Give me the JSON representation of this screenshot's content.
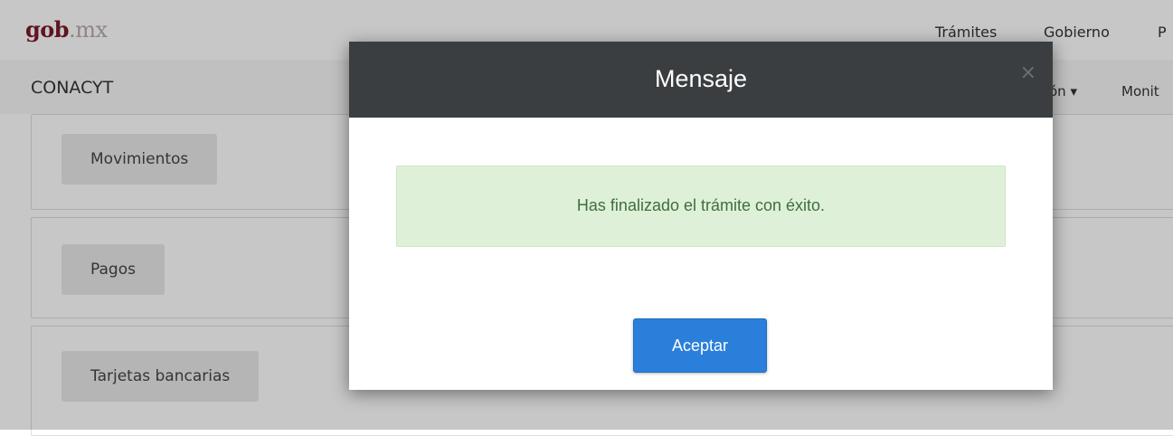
{
  "header": {
    "logo_part1": "gob",
    "logo_part2": ".mx",
    "nav": [
      "Trámites",
      "Gobierno",
      "P"
    ]
  },
  "subnav": {
    "title": "CONACYT",
    "items": [
      "ón ▾",
      "Monit"
    ]
  },
  "panels": [
    "Movimientos",
    "Pagos",
    "Tarjetas bancarias"
  ],
  "modal": {
    "title": "Mensaje",
    "close": "×",
    "message": "Has finalizado el trámite con éxito.",
    "accept_label": "Aceptar"
  },
  "colors": {
    "brand": "#7a1a2a",
    "modal_header": "#3b3e40",
    "alert_bg": "#dff0d8",
    "primary": "#2a7fdb"
  }
}
